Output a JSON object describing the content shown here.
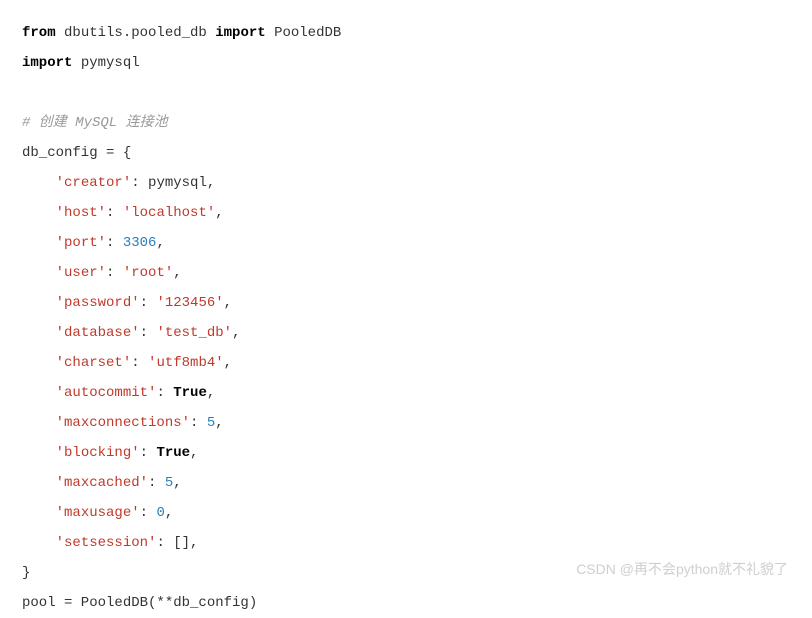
{
  "code": {
    "kw_from": "from",
    "module1": " dbutils.pooled_db ",
    "kw_import1": "import",
    "cls_pooled": " PooledDB",
    "kw_import2": "import",
    "module2": " pymysql",
    "blank": "",
    "comment": "# 创建 MySQL 连接池",
    "assign_open": "db_config = {",
    "indent": "    ",
    "k_creator": "'creator'",
    "v_creator": ": pymysql,",
    "k_host": "'host'",
    "colon_sp": ": ",
    "v_host": "'localhost'",
    "comma": ",",
    "k_port": "'port'",
    "v_port": "3306",
    "k_user": "'user'",
    "v_user": "'root'",
    "k_password": "'password'",
    "v_password": "'123456'",
    "k_database": "'database'",
    "v_database": "'test_db'",
    "k_charset": "'charset'",
    "v_charset": "'utf8mb4'",
    "k_autocommit": "'autocommit'",
    "v_true": "True",
    "k_maxconn": "'maxconnections'",
    "v_five": "5",
    "k_blocking": "'blocking'",
    "k_maxcached": "'maxcached'",
    "k_maxusage": "'maxusage'",
    "v_zero": "0",
    "k_setsession": "'setsession'",
    "v_empty_list": ": [],",
    "close_brace": "}",
    "pool_line_a": "pool = PooledDB(**db_config)"
  },
  "watermark": "CSDN @再不会python就不礼貌了"
}
